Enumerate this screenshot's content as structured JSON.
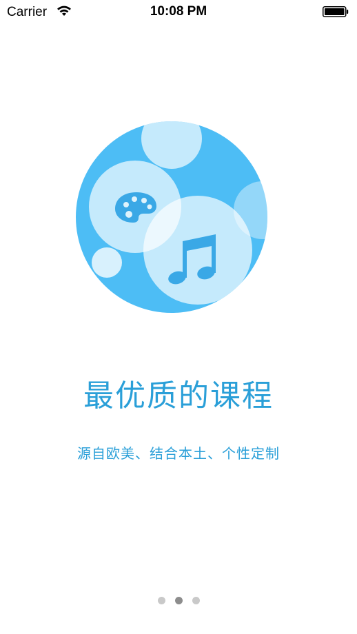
{
  "status_bar": {
    "carrier": "Carrier",
    "time": "10:08 PM",
    "wifi_icon": "wifi-icon",
    "battery_icon": "battery-full-icon"
  },
  "onboarding": {
    "illustration_icons": [
      "palette-icon",
      "music-note-icon"
    ],
    "title": "最优质的课程",
    "subtitle": "源自欧美、结合本土、个性定制"
  },
  "pager": {
    "page_count": 3,
    "current_page": 2
  },
  "colors": {
    "accent": "#2a9fd8",
    "circle_blue": "#4dbdf5",
    "dot_inactive": "#c9c9c9",
    "dot_active": "#8d8d8d"
  }
}
